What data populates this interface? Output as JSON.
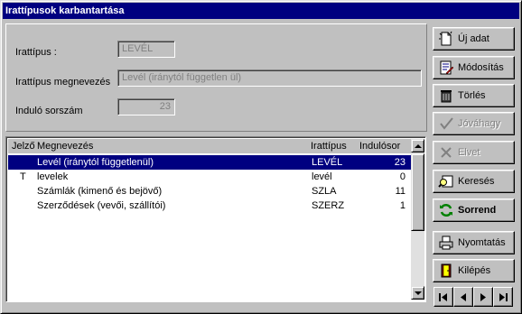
{
  "window": {
    "title": "Irattípusok karbantartása"
  },
  "form": {
    "irattipus_label": "Irattípus :",
    "irattipus_value": "LEVÉL",
    "megnevezes_label": "Irattípus megnevezés",
    "megnevezes_value": "Levél (iránytól független ül)",
    "indulo_label": "Induló sorszám",
    "indulo_value": "23"
  },
  "list": {
    "headers": {
      "jelzo": "Jelző",
      "megnevezes": "Megnevezés",
      "irattipus": "Irattípus",
      "indulosor": "Indulósor"
    },
    "rows": [
      {
        "jelzo": "",
        "megnevezes": "Levél (iránytól függetlenül)",
        "irattipus": "LEVÉL",
        "indulosor": "23",
        "selected": true
      },
      {
        "jelzo": "T",
        "megnevezes": "levelek",
        "irattipus": "levél",
        "indulosor": "0",
        "selected": false
      },
      {
        "jelzo": "",
        "megnevezes": "Számlák (kimenő és bejövő)",
        "irattipus": "SZLA",
        "indulosor": "11",
        "selected": false
      },
      {
        "jelzo": "",
        "megnevezes": "Szerződések (vevői, szállítói)",
        "irattipus": "SZERZ",
        "indulosor": "1",
        "selected": false
      }
    ]
  },
  "buttons": {
    "uj_adat": "Új adat",
    "modositas": "Módosítás",
    "torles": "Törlés",
    "jovahagy": "Jóváhagy",
    "elvet": "Elvet",
    "kereses": "Keresés",
    "sorrend": "Sorrend",
    "nyomtatas": "Nyomtatás",
    "kilepes": "Kilépés"
  },
  "nav": {
    "first": "|◀",
    "prev": "◀",
    "next": "▶",
    "last": "▶|"
  },
  "colors": {
    "titlebar": "#000080",
    "selection": "#000080",
    "face": "#c0c0c0"
  }
}
